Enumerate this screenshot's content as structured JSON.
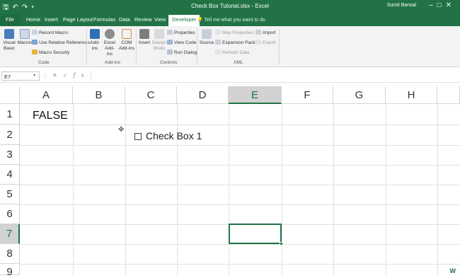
{
  "title_bar": {
    "qat_icons": [
      "save-icon",
      "undo-icon",
      "redo-icon",
      "customize-icon"
    ],
    "document_title": "Check Box Tutorial.xlsx - Excel",
    "user": "Sumit Bansal"
  },
  "tabs": [
    "File",
    "Home",
    "Insert",
    "Page Layout",
    "Formulas",
    "Data",
    "Review",
    "View",
    "Developer"
  ],
  "active_tab": "Developer",
  "tell_me": "Tell me what you want to do",
  "ribbon": {
    "code": {
      "visual_basic": "Visual Basic",
      "macros": "Macros",
      "record_macro": "Record Macro",
      "use_relative": "Use Relative References",
      "macro_security": "Macro Security",
      "label": "Code"
    },
    "addins": {
      "addins": "Add-ins",
      "excel_addins": "Excel Add-ins",
      "com_addins": "COM Add-ins",
      "label": "Add-ins"
    },
    "controls": {
      "insert": "Insert",
      "design_mode": "Design Mode",
      "properties": "Properties",
      "view_code": "View Code",
      "run_dialog": "Run Dialog",
      "label": "Controls"
    },
    "xml": {
      "source": "Source",
      "map_properties": "Map Properties",
      "expansion_packs": "Expansion Packs",
      "refresh_data": "Refresh Data",
      "import": "Import",
      "export": "Export",
      "label": "XML"
    }
  },
  "formula_bar": {
    "name_box": "E7",
    "fx": "fx",
    "value": ""
  },
  "columns": [
    "A",
    "B",
    "C",
    "D",
    "E",
    "F",
    "G",
    "H"
  ],
  "rows": [
    "1",
    "2",
    "3",
    "4",
    "5",
    "6",
    "7",
    "8",
    "9"
  ],
  "selected_cell": "E7",
  "cells": {
    "A1": "FALSE"
  },
  "checkbox": {
    "label": "Check Box 1",
    "checked": false
  },
  "watermark": "W",
  "colors": {
    "excel_green": "#217346"
  }
}
